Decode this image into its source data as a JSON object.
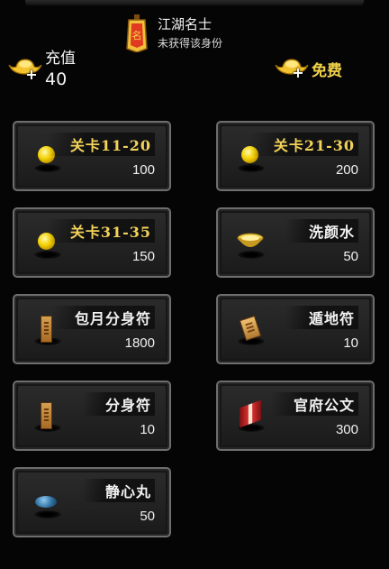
{
  "header": {
    "identity_title": "江湖名士",
    "identity_subtitle": "未获得该身份",
    "badge_glyph": "名"
  },
  "currency": {
    "recharge_label": "充值",
    "balance": "40",
    "free_label": "免费"
  },
  "icons": {
    "plus": "+"
  },
  "items": [
    {
      "name": "关卡11-20",
      "price": "100",
      "icon": "gold-coin-icon"
    },
    {
      "name": "关卡21-30",
      "price": "200",
      "icon": "gold-coin-icon"
    },
    {
      "name": "关卡31-35",
      "price": "150",
      "icon": "gold-coin-icon"
    },
    {
      "name": "洗颜水",
      "price": "50",
      "icon": "wash-bowl-icon"
    },
    {
      "name": "包月分身符",
      "price": "1800",
      "icon": "talisman-icon"
    },
    {
      "name": "遁地符",
      "price": "10",
      "icon": "earth-talisman-icon"
    },
    {
      "name": "分身符",
      "price": "10",
      "icon": "talisman-icon"
    },
    {
      "name": "官府公文",
      "price": "300",
      "icon": "official-document-icon"
    },
    {
      "name": "静心丸",
      "price": "50",
      "icon": "calm-pill-icon"
    }
  ],
  "colors": {
    "gold_text": "#f2d25a",
    "card_border": "#6e6e6e",
    "background": "#050505"
  }
}
